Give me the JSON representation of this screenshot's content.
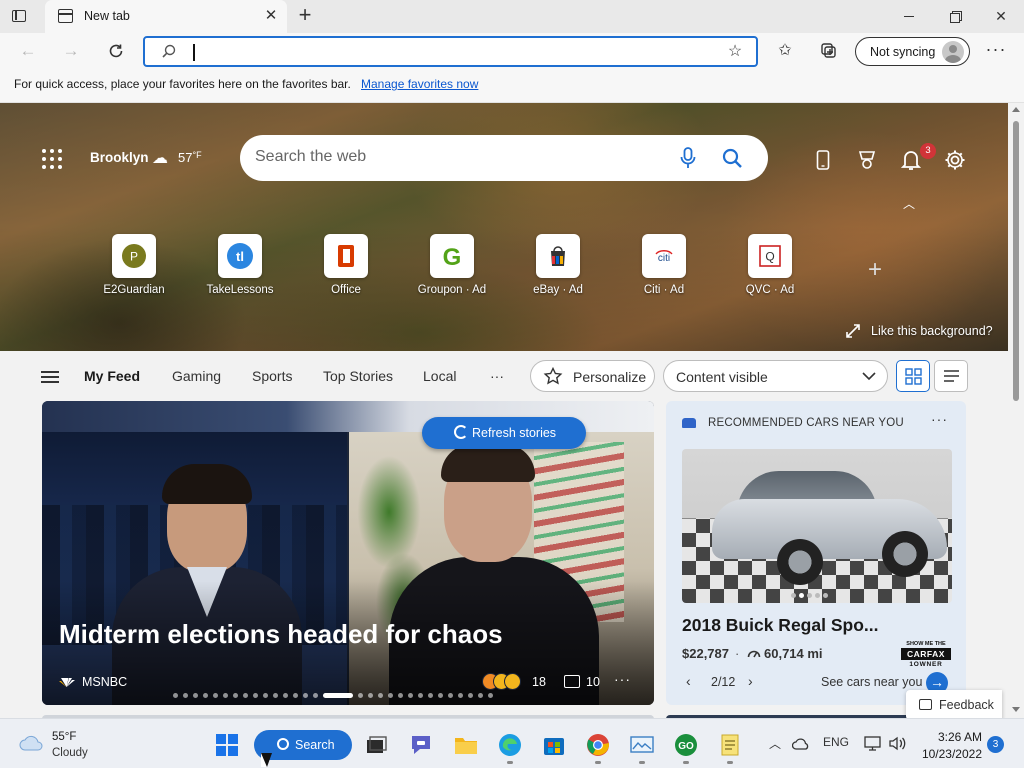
{
  "browser": {
    "tab_title": "New tab",
    "sync_label": "Not syncing",
    "address_value": "",
    "favorites_bar": {
      "text": "For quick access, place your favorites here on the favorites bar.",
      "link": "Manage favorites now"
    }
  },
  "newtab": {
    "weather": {
      "location": "Brooklyn",
      "temp": "57",
      "unit": "°F"
    },
    "search_placeholder": "Search the web",
    "notification_count": "3",
    "tiles": [
      {
        "label": "E2Guardian",
        "letter": "P",
        "color": "#7a7a1e"
      },
      {
        "label": "TakeLessons",
        "letter": "tl",
        "color": "#2b86e0"
      },
      {
        "label": "Office",
        "letter": "O",
        "color": "#d83b01"
      },
      {
        "label": "Groupon · Ad",
        "letter": "G",
        "color": "#53a318"
      },
      {
        "label": "eBay · Ad",
        "letter": "eBay",
        "color": "#e53238"
      },
      {
        "label": "Citi · Ad",
        "letter": "citi",
        "color": "#1b4a8c"
      },
      {
        "label": "QVC · Ad",
        "letter": "Q",
        "color": "#c22"
      }
    ],
    "background_label": "Like this background?"
  },
  "feed": {
    "tabs": [
      "My Feed",
      "Gaming",
      "Sports",
      "Top Stories",
      "Local"
    ],
    "more_label": "···",
    "personalize_label": "Personalize",
    "content_select": "Content visible",
    "refresh_label": "Refresh stories",
    "main_story": {
      "headline": "Midterm elections headed for chaos",
      "source": "MSNBC",
      "reactions": "18",
      "comments": "10",
      "page_index": 15,
      "page_count": 30
    },
    "cars": {
      "heading": "RECOMMENDED CARS NEAR YOU",
      "title": "2018 Buick Regal Spo...",
      "price": "$22,787",
      "separator": "·",
      "miles": "60,714 mi",
      "pager": "2/12",
      "see_label": "See cars near you",
      "carfax_top": "SHOW ME THE",
      "carfax_mid": "CARFAX",
      "carfax_bot": "1OWNER",
      "photo_index": 1,
      "photo_count": 5
    },
    "feedback_label": "Feedback"
  },
  "taskbar": {
    "temp": "55°F",
    "condition": "Cloudy",
    "search_label": "Search",
    "language": "ENG",
    "time": "3:26 AM",
    "date": "10/23/2022",
    "notification_count": "3"
  },
  "colors": {
    "accent": "#1f6fd1",
    "badge_red": "#d13438",
    "cars_card_bg": "#e3ebf5"
  }
}
